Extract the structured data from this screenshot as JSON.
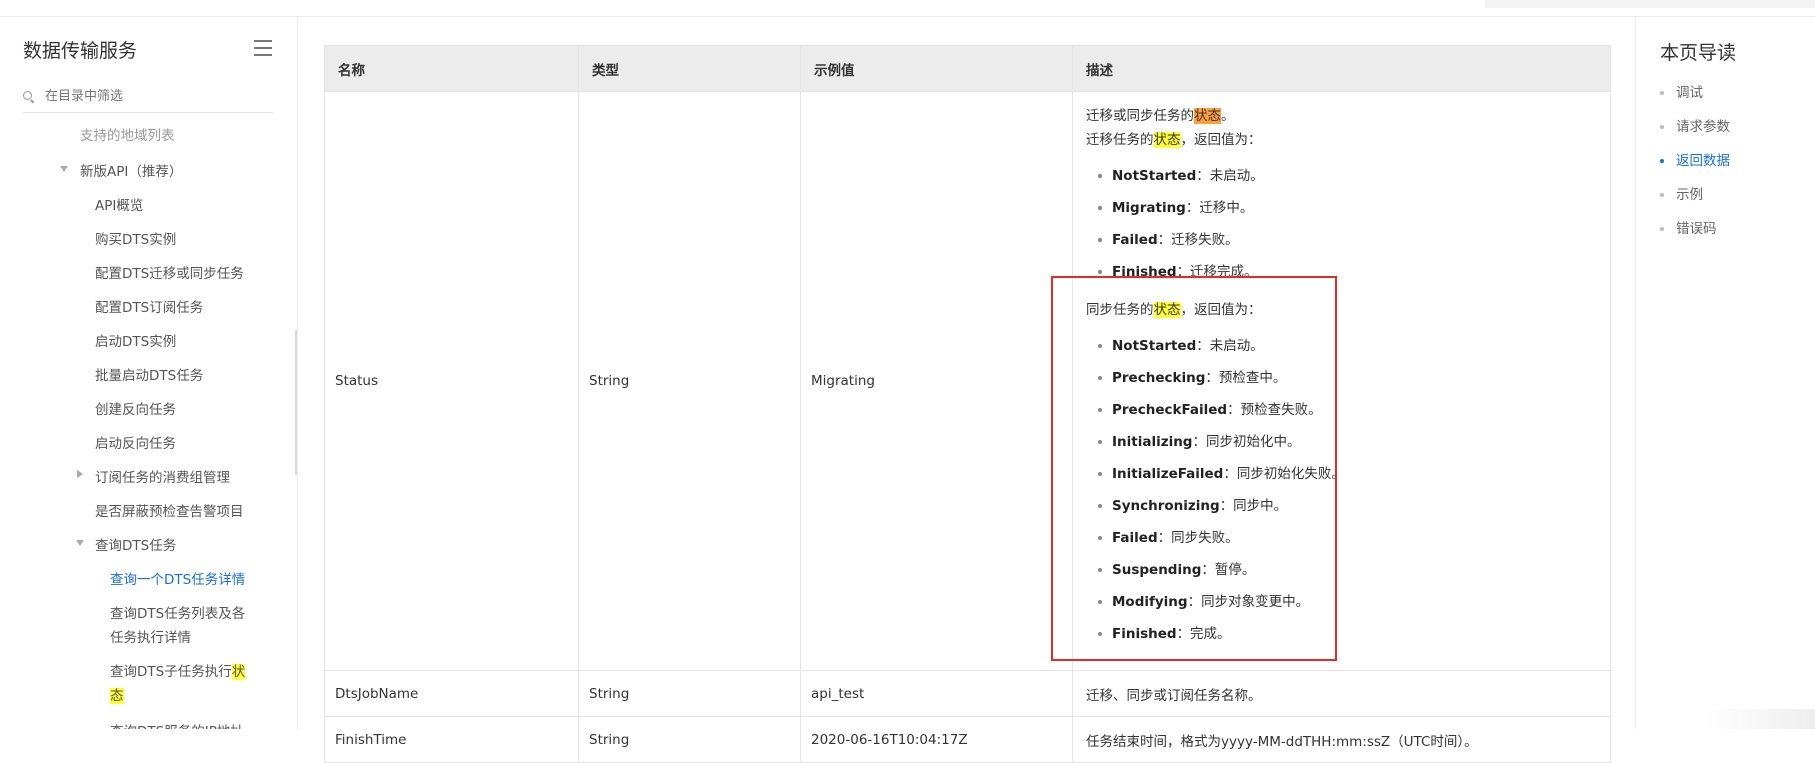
{
  "sidebar": {
    "title": "数据传输服务",
    "search_placeholder": "在目录中筛选",
    "items": [
      {
        "label": "支持的地域列表"
      },
      {
        "label": "新版API（推荐）"
      },
      {
        "label": "API概览"
      },
      {
        "label": "购买DTS实例"
      },
      {
        "label": "配置DTS迁移或同步任务"
      },
      {
        "label": "配置DTS订阅任务"
      },
      {
        "label": "启动DTS实例"
      },
      {
        "label": "批量启动DTS任务"
      },
      {
        "label": "创建反向任务"
      },
      {
        "label": "启动反向任务"
      },
      {
        "label": "订阅任务的消费组管理"
      },
      {
        "label": "是否屏蔽预检查告警项目"
      },
      {
        "label": "查询DTS任务"
      },
      {
        "label": "查询一个DTS任务详情"
      },
      {
        "label_line1": "查询DTS任务列表及各",
        "label_line2": "任务执行详情"
      },
      {
        "label_pre": "查询DTS子任务执行",
        "label_hl1": "状",
        "label_hl2": "态"
      },
      {
        "label": "查询DTS服务的IP地址"
      }
    ]
  },
  "table": {
    "headers": [
      "名称",
      "类型",
      "示例值",
      "描述"
    ],
    "row1": {
      "name": "Status",
      "type": "String",
      "example": "Migrating",
      "desc_line1_pre": "迁移或同步任务的",
      "desc_line1_hl": "状态",
      "desc_line1_post": "。",
      "desc_line2_pre": "迁移任务的",
      "desc_line2_hl": "状态",
      "desc_line2_post": "，返回值为：",
      "migrate_values": [
        {
          "key": "NotStarted",
          "text": "：未启动。"
        },
        {
          "key": "Migrating",
          "text": "：迁移中。"
        },
        {
          "key": "Failed",
          "text": "：迁移失败。"
        },
        {
          "key": "Finished",
          "text": "：迁移完成。"
        }
      ],
      "desc_line3_pre": "同步任务的",
      "desc_line3_hl": "状态",
      "desc_line3_post": "，返回值为：",
      "sync_values": [
        {
          "key": "NotStarted",
          "text": "：未启动。"
        },
        {
          "key": "Prechecking",
          "text": "：预检查中。"
        },
        {
          "key": "PrecheckFailed",
          "text": "：预检查失败。"
        },
        {
          "key": "Initializing",
          "text": "：同步初始化中。"
        },
        {
          "key": "InitializeFailed",
          "text": "：同步初始化失败。"
        },
        {
          "key": "Synchronizing",
          "text": "：同步中。"
        },
        {
          "key": "Failed",
          "text": "：同步失败。"
        },
        {
          "key": "Suspending",
          "text": "：暂停。"
        },
        {
          "key": "Modifying",
          "text": "：同步对象变更中。"
        },
        {
          "key": "Finished",
          "text": "：完成。"
        }
      ]
    },
    "row2": {
      "name": "DtsJobName",
      "type": "String",
      "example": "api_test",
      "desc": "迁移、同步或订阅任务名称。"
    },
    "row3": {
      "name": "FinishTime",
      "type": "String",
      "example": "2020-06-16T10:04:17Z",
      "desc": "任务结束时间，格式为yyyy-MM-ddTHH:mm:ssZ（UTC时间）。"
    }
  },
  "right_nav": {
    "title": "本页导读",
    "items": [
      "调试",
      "请求参数",
      "返回数据",
      "示例",
      "错误码"
    ]
  }
}
